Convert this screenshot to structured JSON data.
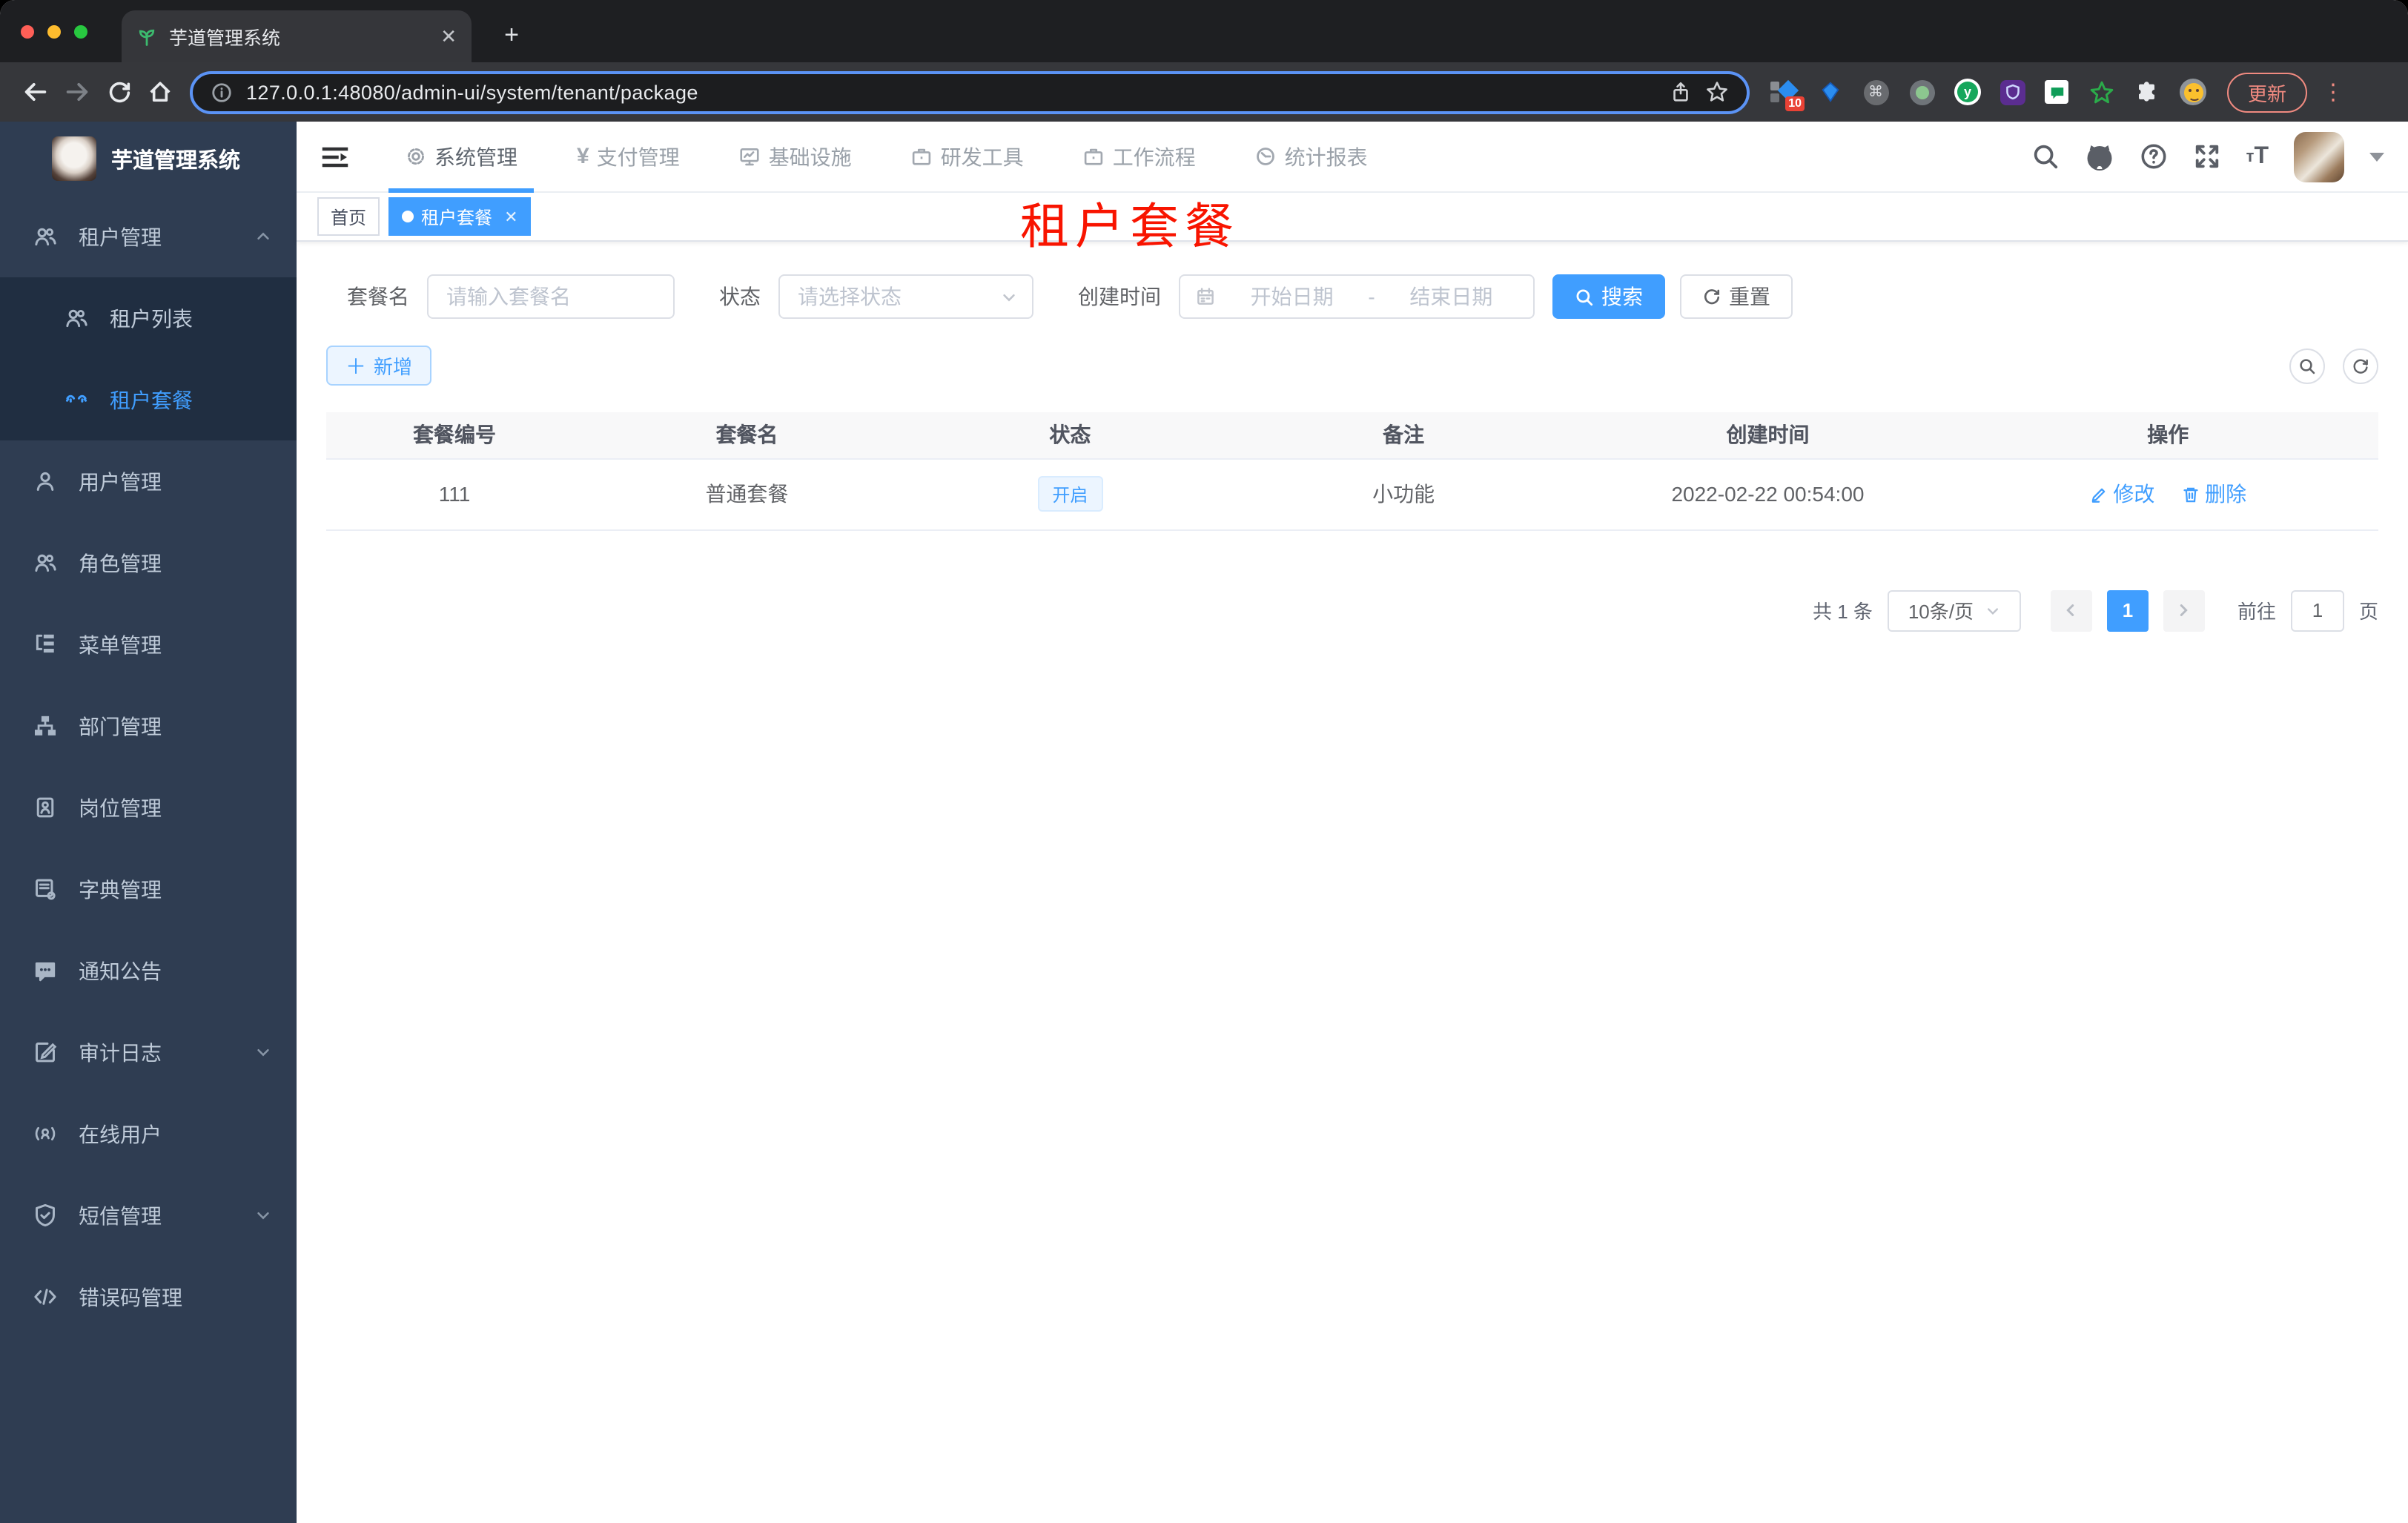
{
  "browser": {
    "tab_title": "芋道管理系统",
    "url": "127.0.0.1:48080/admin-ui/system/tenant/package",
    "update_label": "更新",
    "ext_badge": "10"
  },
  "sidebar": {
    "logo_title": "芋道管理系统",
    "menu": [
      {
        "label": "租户管理"
      },
      {
        "label": "租户列表"
      },
      {
        "label": "租户套餐"
      },
      {
        "label": "用户管理"
      },
      {
        "label": "角色管理"
      },
      {
        "label": "菜单管理"
      },
      {
        "label": "部门管理"
      },
      {
        "label": "岗位管理"
      },
      {
        "label": "字典管理"
      },
      {
        "label": "通知公告"
      },
      {
        "label": "审计日志"
      },
      {
        "label": "在线用户"
      },
      {
        "label": "短信管理"
      },
      {
        "label": "错误码管理"
      }
    ]
  },
  "navbar": {
    "menus": [
      {
        "label": "系统管理"
      },
      {
        "label": "支付管理"
      },
      {
        "label": "基础设施"
      },
      {
        "label": "研发工具"
      },
      {
        "label": "工作流程"
      },
      {
        "label": "统计报表"
      }
    ]
  },
  "tags": {
    "home": "首页",
    "active": "租户套餐"
  },
  "overlay": {
    "title": "租户套餐"
  },
  "filters": {
    "name_label": "套餐名",
    "name_placeholder": "请输入套餐名",
    "status_label": "状态",
    "status_placeholder": "请选择状态",
    "date_label": "创建时间",
    "date_start": "开始日期",
    "date_sep": "-",
    "date_end": "结束日期",
    "search": "搜索",
    "reset": "重置"
  },
  "actions": {
    "add": "新增"
  },
  "table": {
    "columns": [
      "套餐编号",
      "套餐名",
      "状态",
      "备注",
      "创建时间",
      "操作"
    ],
    "rows": [
      {
        "id": "111",
        "name": "普通套餐",
        "status": "开启",
        "remark": "小功能",
        "created": "2022-02-22 00:54:00",
        "edit": "修改",
        "delete": "删除"
      }
    ]
  },
  "pagination": {
    "total": "共 1 条",
    "page_size": "10条/页",
    "page": "1",
    "goto": "前往",
    "goto_value": "1",
    "unit": "页"
  },
  "colors": {
    "primary": "#409eff",
    "overlay_red": "#f81400",
    "sidebar_bg": "#2f3d52",
    "submenu_bg": "#202e41",
    "tag_active_bg": "#409eff"
  }
}
